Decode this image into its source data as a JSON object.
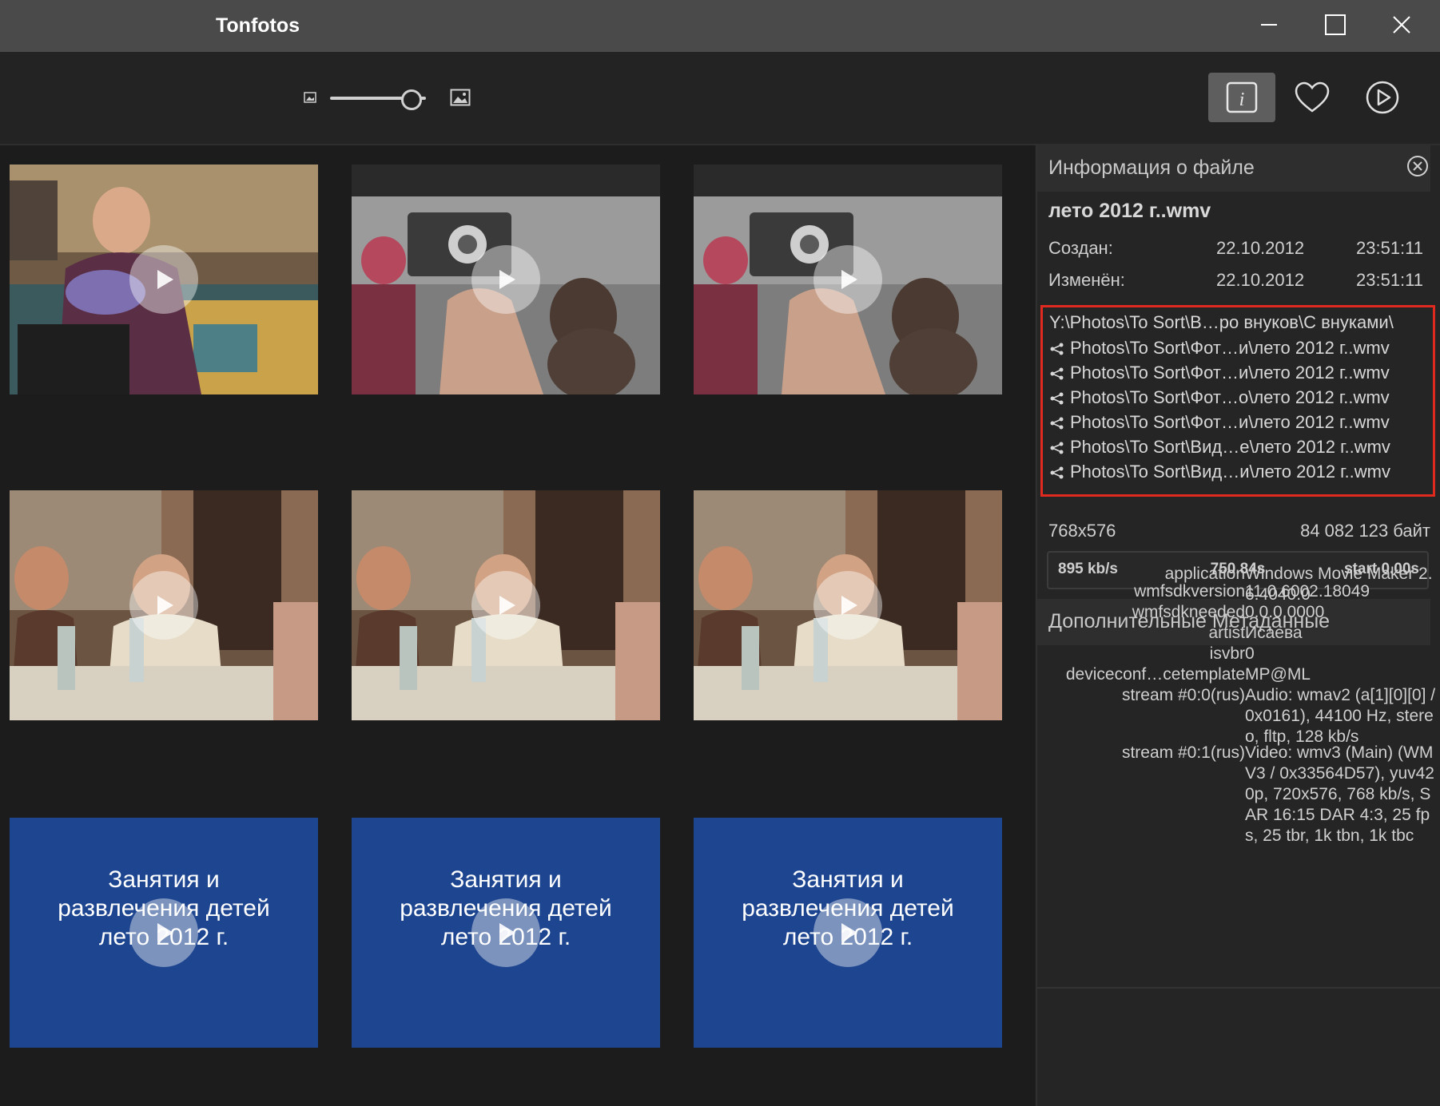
{
  "app": {
    "title": "Tonfotos"
  },
  "thumbnail_size": 0.85,
  "gallery": {
    "tiles": [
      {
        "scene": "grandma"
      },
      {
        "scene": "camera"
      },
      {
        "scene": "camera"
      },
      {
        "scene": "party"
      },
      {
        "scene": "party"
      },
      {
        "scene": "party"
      },
      {
        "scene": "blue",
        "text": [
          "Занятия и",
          "развлечения детей",
          "лето 2012 г."
        ]
      },
      {
        "scene": "blue",
        "text": [
          "Занятия и",
          "развлечения детей",
          "лето 2012 г."
        ]
      },
      {
        "scene": "blue",
        "text": [
          "Занятия и",
          "развлечения детей",
          "лето 2012 г."
        ]
      }
    ]
  },
  "info": {
    "header": "Информация о файле",
    "file_name": "лето 2012 г..wmv",
    "created_label": "Создан:",
    "created_date": "22.10.2012",
    "created_time": "23:51:11",
    "modified_label": "Изменён:",
    "modified_date": "22.10.2012",
    "modified_time": "23:51:11",
    "primary_path": "Y:\\Photos\\To Sort\\В…ро внуков\\С внуками\\",
    "linked_paths": [
      "Photos\\To Sort\\Фот…и\\лето 2012 г..wmv",
      "Photos\\To Sort\\Фот…и\\лето 2012 г..wmv",
      "Photos\\To Sort\\Фот…о\\лето 2012 г..wmv",
      "Photos\\To Sort\\Фот…и\\лето 2012 г..wmv",
      "Photos\\To Sort\\Вид…е\\лето 2012 г..wmv",
      "Photos\\To Sort\\Вид…и\\лето 2012 г..wmv"
    ],
    "resolution": "768x576",
    "file_size": "84 082 123 байт",
    "bitrate": "895 kb/s",
    "duration": "750.84s",
    "start": "start 0.00s"
  },
  "metadata": {
    "header": "Дополнительные Метаданные",
    "rows": [
      {
        "key": "application",
        "value": "Windows Movie Maker 2.6.4040.0"
      },
      {
        "key": "wmfsdkversion",
        "value": "11.0.6002.18049"
      },
      {
        "key": "wmfsdkneeded",
        "value": "0.0.0.0000"
      },
      {
        "key": "artist",
        "value": "Исаева"
      },
      {
        "key": "isvbr",
        "value": "0"
      },
      {
        "key": "deviceconf…cetemplate",
        "value": "MP@ML"
      },
      {
        "key": "stream #0:0(rus)",
        "value": "Audio: wmav2 (a[1][0][0] / 0x0161), 44100 Hz, stereo, fltp, 128 kb/s"
      },
      {
        "key": "stream #0:1(rus)",
        "value": "Video: wmv3 (Main) (WMV3 / 0x33564D57), yuv420p, 720x576, 768 kb/s, SAR 16:15 DAR 4:3, 25 fps, 25 tbr, 1k tbn, 1k tbc"
      }
    ]
  }
}
